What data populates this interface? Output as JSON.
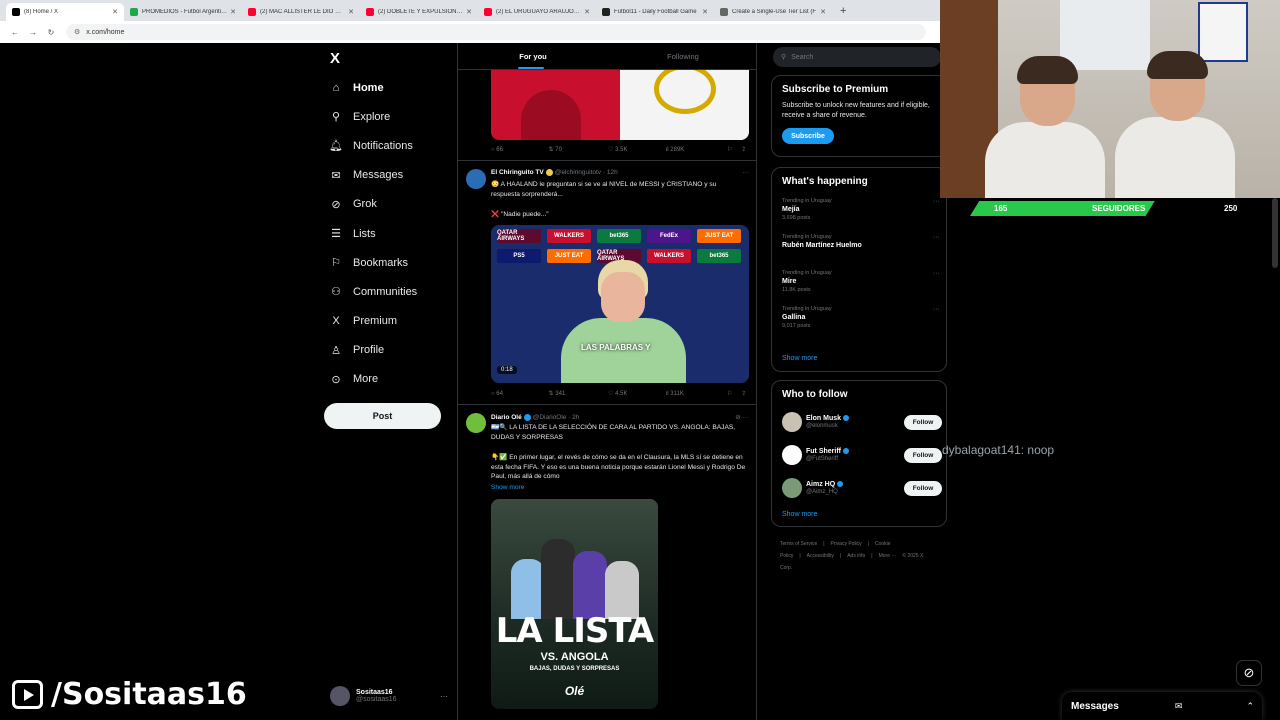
{
  "browser": {
    "tabs": [
      {
        "title": "(8) Home / X",
        "color": "#000000",
        "active": true
      },
      {
        "title": "PROMEDIOS - Futbol Argentino",
        "color": "#1ba94c"
      },
      {
        "title": "(2) MAC ALLISTER LE DIO UN T",
        "color": "#ff0033"
      },
      {
        "title": "(2) DOBLETE Y EXPULSIÓN DE",
        "color": "#ff0033"
      },
      {
        "title": "(2) EL URUGUAYO ARAÚJO REA",
        "color": "#ff0033"
      },
      {
        "title": "Futbol11 - Daily Football Game",
        "color": "#222222"
      },
      {
        "title": "Create a Single-Use Tier List (F",
        "color": "#666666"
      }
    ],
    "new_tab": "+",
    "url": "x.com/home"
  },
  "nav": {
    "logo": "X",
    "items": [
      {
        "label": "Home",
        "icon": "home-icon",
        "glyph": "⌂"
      },
      {
        "label": "Explore",
        "icon": "search-icon",
        "glyph": "⚲"
      },
      {
        "label": "Notifications",
        "icon": "bell-icon",
        "glyph": "🔔︎"
      },
      {
        "label": "Messages",
        "icon": "mail-icon",
        "glyph": "✉"
      },
      {
        "label": "Grok",
        "icon": "grok-icon",
        "glyph": "⊘"
      },
      {
        "label": "Lists",
        "icon": "list-icon",
        "glyph": "☰"
      },
      {
        "label": "Bookmarks",
        "icon": "bookmark-icon",
        "glyph": "⚐"
      },
      {
        "label": "Communities",
        "icon": "communities-icon",
        "glyph": "⚇"
      },
      {
        "label": "Premium",
        "icon": "x-premium-icon",
        "glyph": "X"
      },
      {
        "label": "Profile",
        "icon": "profile-icon",
        "glyph": "♙"
      },
      {
        "label": "More",
        "icon": "more-circle-icon",
        "glyph": "⊙"
      }
    ],
    "post_label": "Post",
    "account": {
      "name": "Sositaas16",
      "handle": "@sositaas16",
      "menu": "···"
    }
  },
  "feed": {
    "tabs": [
      "For you",
      "Following"
    ],
    "tweet0_actions": {
      "replies": "66",
      "reposts": "70",
      "likes": "3.5K",
      "views": "289K"
    },
    "tweet1": {
      "name": "El Chiringuito TV",
      "handle": "@elchiringuitotv · 12h",
      "text1": "😳 A HAALAND le preguntan si se ve al NIVEL de MESSI y CRISTIANO y su respuesta sorprenderá...",
      "text2": "❌ \"Nadie puede...\"",
      "sponsors": [
        "QATAR AIRWAYS",
        "WALKERS",
        "bet365",
        "FedEx",
        "JUST EAT",
        "PS5",
        "JUST EAT",
        "QATAR AIRWAYS",
        "WALKERS",
        "bet365"
      ],
      "caption": "LAS PALABRAS Y",
      "duration": "0:18",
      "actions": {
        "replies": "64",
        "reposts": "341",
        "likes": "4.5K",
        "views": "311K"
      }
    },
    "tweet2": {
      "name": "Diario Olé",
      "handle": "@DiarioOle · 2h",
      "text1": "🇦🇷🔍 LA LISTA DE LA SELECCIÓN DE CARA AL PARTIDO VS. ANGOLA: BAJAS, DUDAS Y SORPRESAS",
      "text2": "👇✅ En primer lugar, el revés de cómo se da en el Clausura, la MLS sí se detiene en esta fecha FIFA. Y eso es una buena noticia porque estarán Lionel Messi y Rodrigo De Paul, más allá de cómo",
      "show_more": "Show more",
      "poster": {
        "title": "LA LISTA",
        "vs": "VS. ANGOLA",
        "sub": "BAJAS, DUDAS Y SORPRESAS",
        "brand": "Olé"
      }
    }
  },
  "right": {
    "search_placeholder": "Search",
    "premium": {
      "title": "Subscribe to Premium",
      "text": "Subscribe to unlock new features and if eligible, receive a share of revenue.",
      "button": "Subscribe"
    },
    "happening": {
      "title": "What's happening",
      "trends": [
        {
          "context": "Trending in Uruguay",
          "name": "Mejía",
          "posts": "3,698 posts"
        },
        {
          "context": "Trending in Uruguay",
          "name": "Rubén Martínez Huelmo",
          "posts": ""
        },
        {
          "context": "Trending in Uruguay",
          "name": "Mire",
          "posts": "11.8K posts"
        },
        {
          "context": "Trending in Uruguay",
          "name": "Gallina",
          "posts": "9,017 posts"
        }
      ],
      "show_more": "Show more"
    },
    "who": {
      "title": "Who to follow",
      "accounts": [
        {
          "name": "Elon Musk",
          "handle": "@elonmusk",
          "button": "Follow",
          "color": "#c9c2b4"
        },
        {
          "name": "Fut Sheriff",
          "handle": "@FutSheriff",
          "button": "Follow",
          "color": "#ffffff"
        },
        {
          "name": "Aimz HQ",
          "handle": "@Aimz_HQ",
          "button": "Follow",
          "color": "#7a9a78"
        }
      ],
      "show_more": "Show more"
    },
    "footer": [
      "Terms of Service",
      "|",
      "Privacy Policy",
      "|",
      "Cookie Policy",
      "|",
      "Accessibility",
      "|",
      "Ads info",
      "|",
      "More ···",
      "© 2025 X Corp."
    ]
  },
  "overlay": {
    "followers_current": "165",
    "followers_label": "SEGUIDORES",
    "followers_goal": "250",
    "followers_progress": 0.66,
    "chat_message": "dybalagoat141: noop",
    "channel": "/Sositaas16",
    "messages_label": "Messages"
  }
}
